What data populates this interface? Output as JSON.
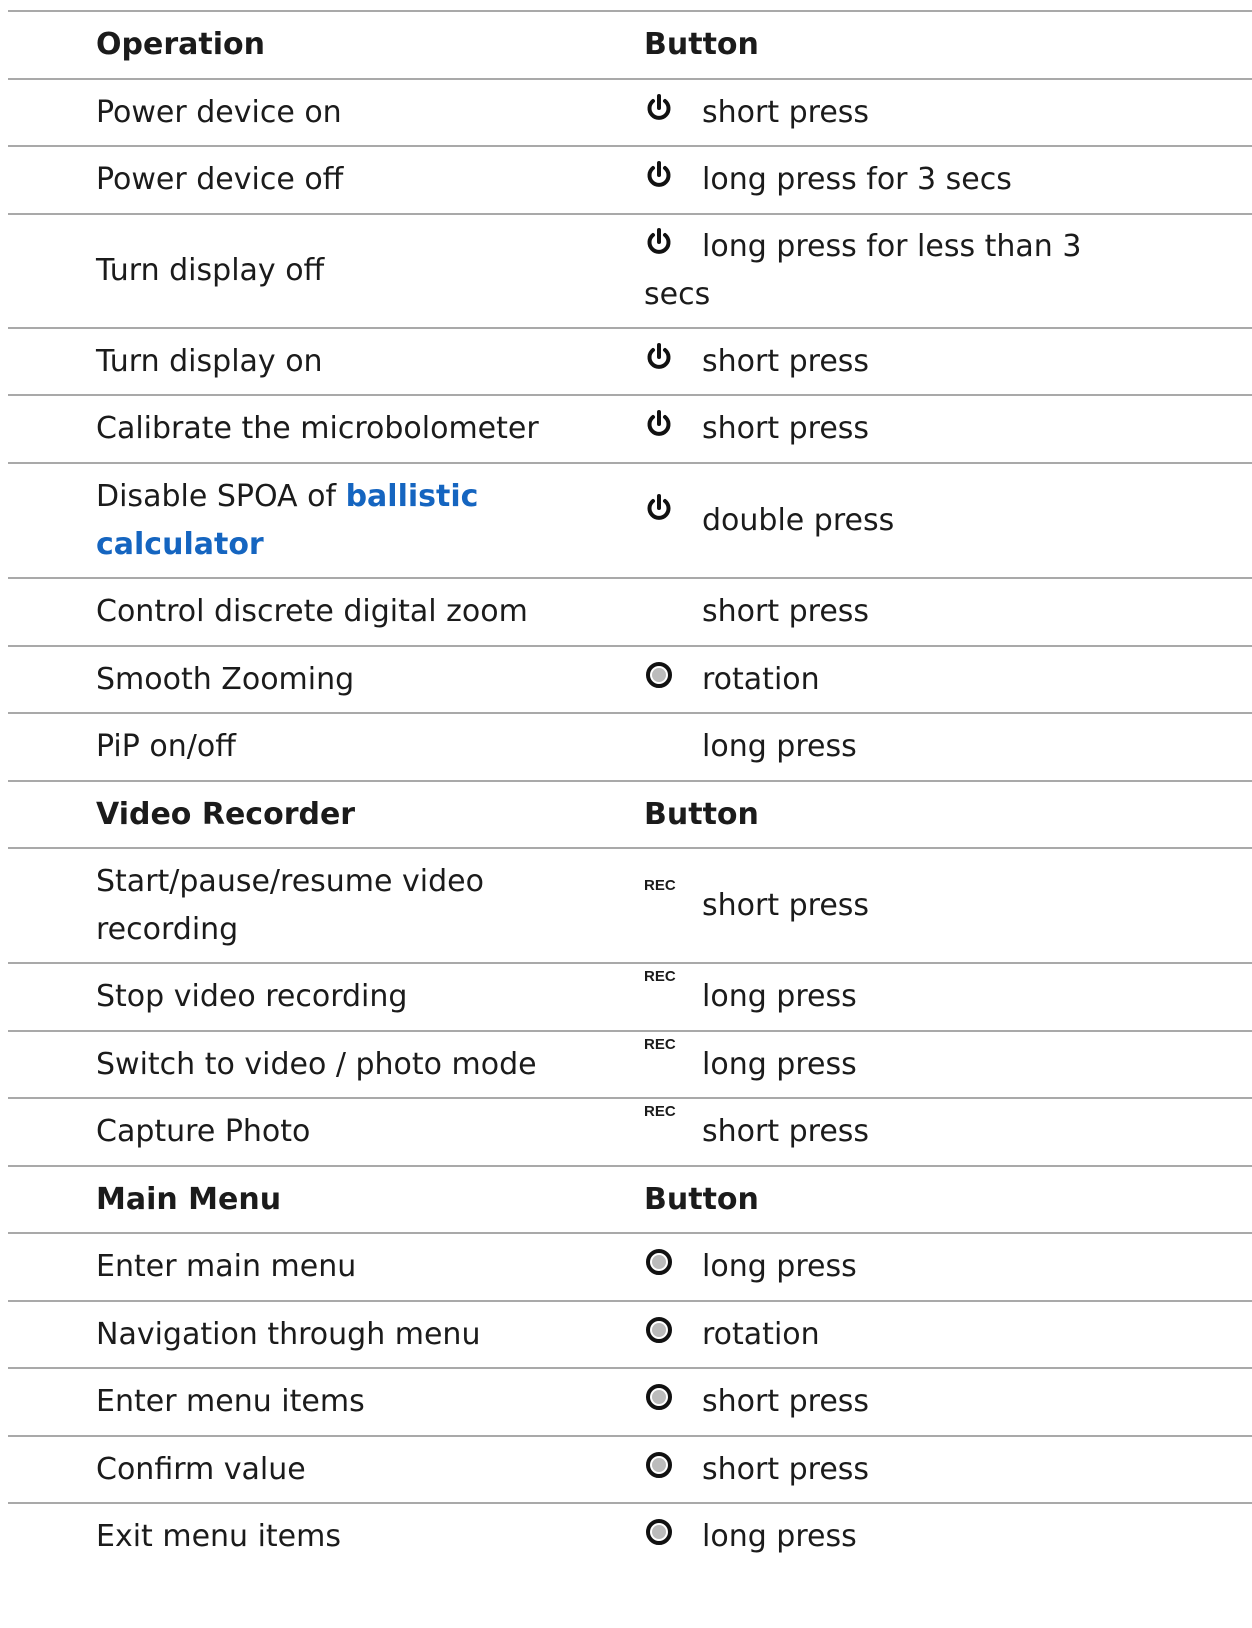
{
  "sections": {
    "operation": {
      "header": {
        "op": "Operation",
        "btn": "Button"
      },
      "rows": [
        {
          "op": "Power device on",
          "icon": "power-icon",
          "action": "short press"
        },
        {
          "op": "Power device off",
          "icon": "power-icon",
          "action": "long press for 3 secs"
        },
        {
          "op": "Turn display off",
          "icon": "power-icon",
          "action_line1": "long press for less than 3",
          "action_line2": "secs"
        },
        {
          "op": "Turn display on",
          "icon": "power-icon",
          "action": "short press"
        },
        {
          "op": "Calibrate the microbolometer",
          "icon": "power-icon",
          "action": "short press"
        },
        {
          "op_prefix": "Disable SPOA of ",
          "op_link_line1": "ballistic",
          "op_link_line2": "calculator",
          "icon": "power-icon",
          "action": "double press"
        },
        {
          "op": "Control discrete digital zoom",
          "icon": "",
          "action": "short press"
        },
        {
          "op": "Smooth Zooming",
          "icon": "dial-icon",
          "action": "rotation"
        },
        {
          "op": "PiP on/off",
          "icon": "",
          "action": "long press"
        }
      ]
    },
    "video": {
      "header": {
        "op": "Video Recorder",
        "btn": "Button"
      },
      "rec_label": "REC",
      "rows": [
        {
          "op_line1": "Start/pause/resume video",
          "op_line2": "recording",
          "icon": "rec-icon",
          "action": "short press"
        },
        {
          "op": "Stop video recording",
          "icon": "rec-icon",
          "action": "long press"
        },
        {
          "op": "Switch to video / photo mode",
          "icon": "rec-icon",
          "action": "long press"
        },
        {
          "op": "Capture Photo",
          "icon": "rec-icon",
          "action": "short press"
        }
      ]
    },
    "menu": {
      "header": {
        "op": "Main Menu",
        "btn": "Button"
      },
      "rows": [
        {
          "op": "Enter main menu",
          "icon": "dial-icon",
          "action": "long press"
        },
        {
          "op": "Navigation through menu",
          "icon": "dial-icon",
          "action": "rotation"
        },
        {
          "op": "Enter menu items",
          "icon": "dial-icon",
          "action": "short press"
        },
        {
          "op": "Confirm value",
          "icon": "dial-icon",
          "action": "short press"
        },
        {
          "op": "Exit menu items",
          "icon": "dial-icon",
          "action": "long press"
        }
      ]
    }
  }
}
